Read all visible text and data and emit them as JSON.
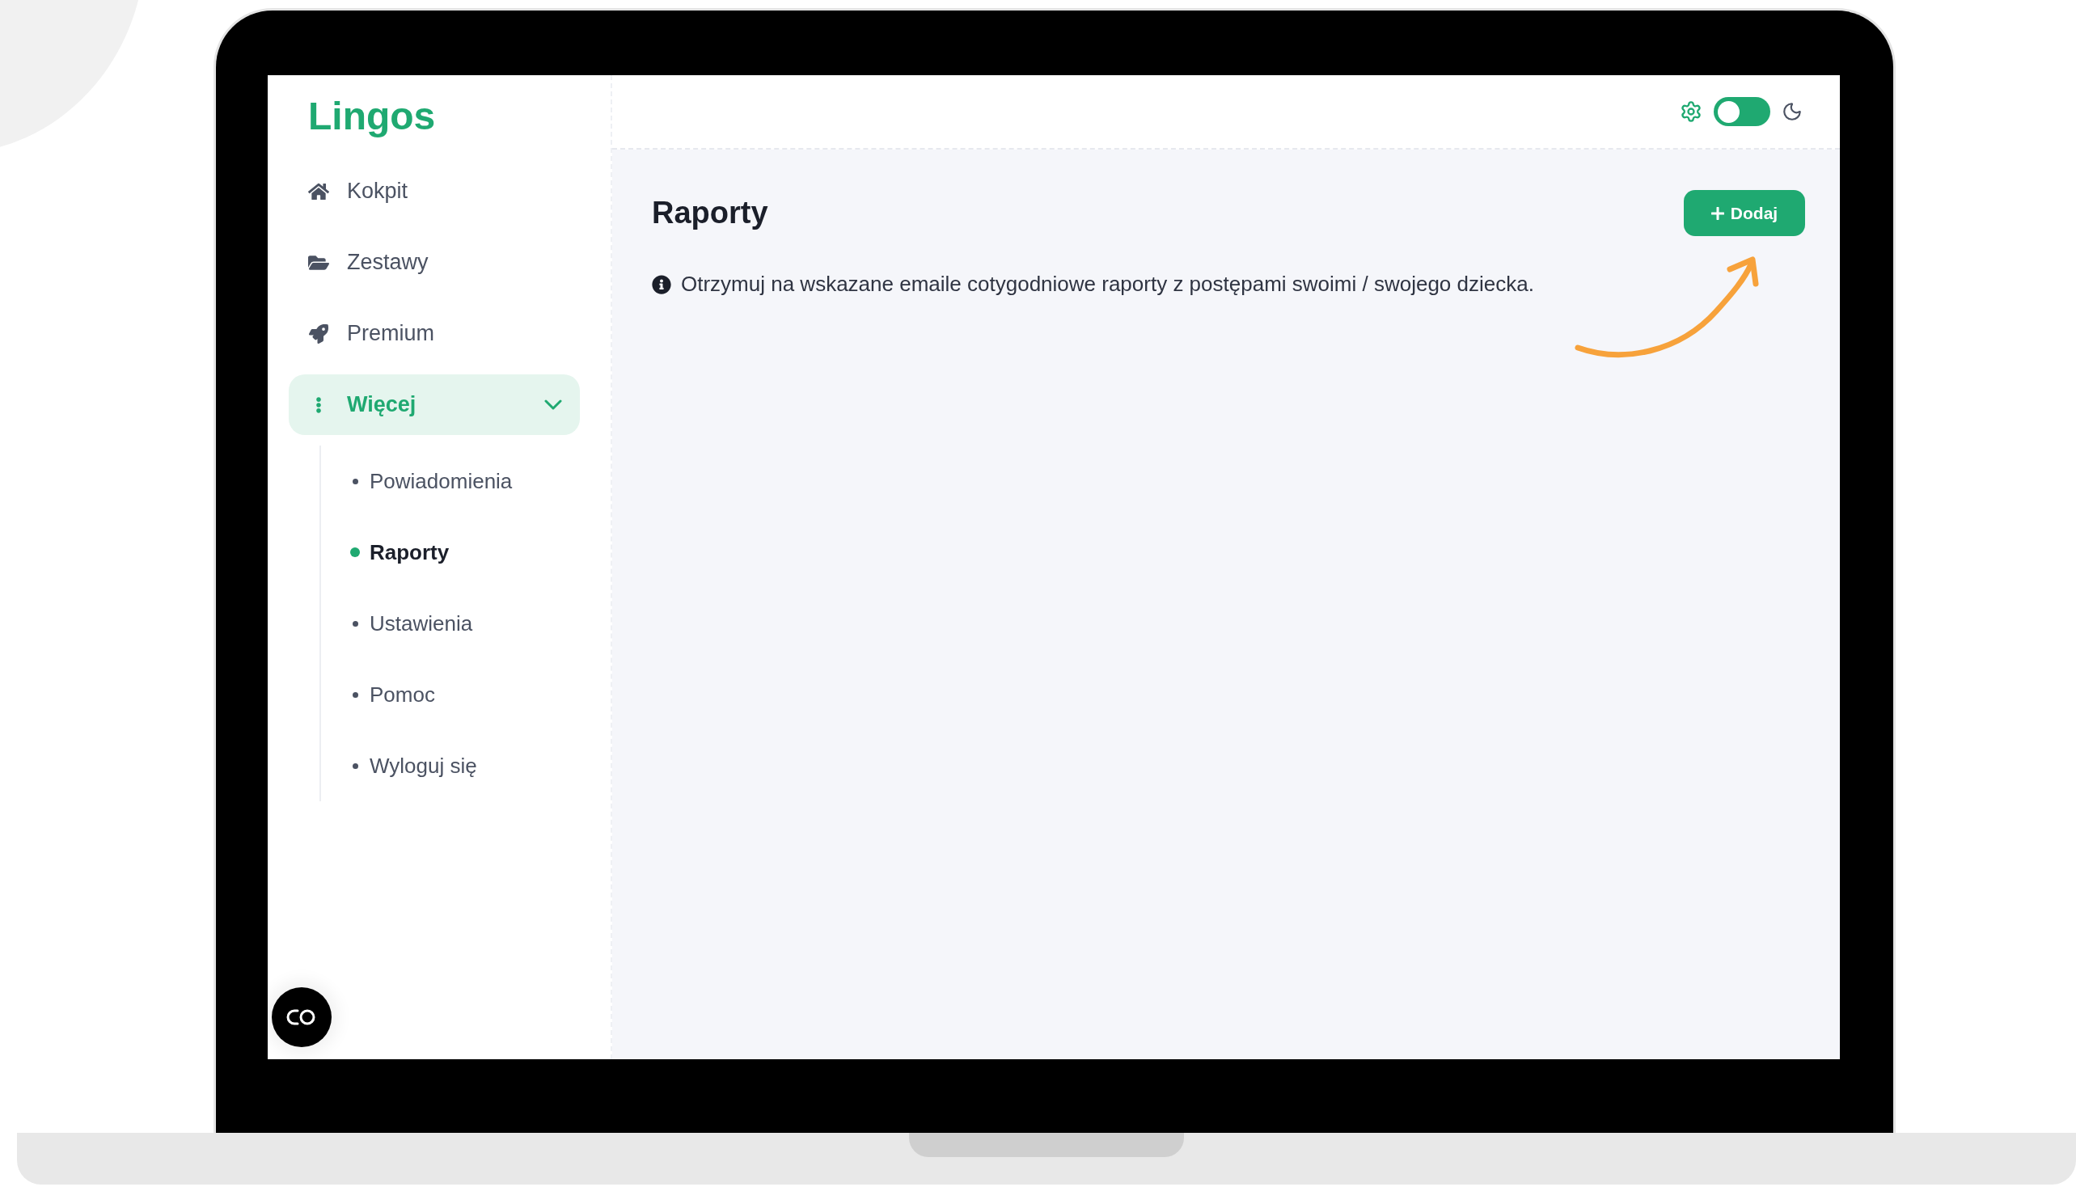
{
  "app": {
    "logo": "Lingos"
  },
  "nav": [
    {
      "kind": "link",
      "label": "Kokpit",
      "selected": false
    },
    {
      "kind": "link",
      "label": "Zestawy",
      "selected": false
    },
    {
      "kind": "link",
      "label": "Premium",
      "selected": false
    },
    {
      "kind": "group",
      "label": "Więcej",
      "selected": true,
      "expanded": true,
      "children": [
        {
          "label": "Powiadomienia",
          "selected": false
        },
        {
          "label": "Raporty",
          "selected": true
        },
        {
          "label": "Ustawienia",
          "selected": false
        },
        {
          "label": "Pomoc",
          "selected": false
        },
        {
          "label": "Wyloguj się",
          "selected": false
        }
      ]
    }
  ],
  "theme_toggle": {
    "on": false
  },
  "page": {
    "title": "Raporty",
    "add_button": "Dodaj",
    "info": "Otrzymuj na wskazane emaile cotygodniowe raporty z postępami swoimi / swojego dziecka."
  }
}
